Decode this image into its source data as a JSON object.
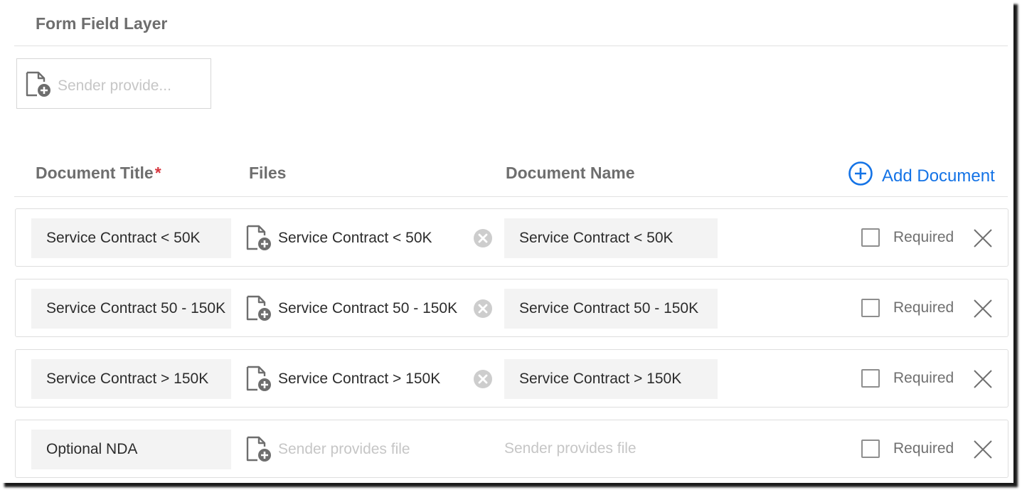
{
  "section": {
    "title": "Form Field Layer"
  },
  "layer_field": {
    "icon": "file-add-icon",
    "placeholder": "Sender provide..."
  },
  "columns": {
    "title": "Document Title",
    "required_marker": "*",
    "files": "Files",
    "name": "Document Name"
  },
  "add_document": {
    "icon": "add-circle-icon",
    "label": "Add Document"
  },
  "colors": {
    "accent": "#1473e6",
    "required_marker": "#d7373f",
    "placeholder": "#c6c6c6"
  },
  "rows": [
    {
      "title": "Service Contract < 50K",
      "file": "Service Contract < 50K",
      "document_name": "Service Contract < 50K",
      "required_label": "Required",
      "required_checked": false
    },
    {
      "title": "Service Contract 50 - 150K",
      "file": "Service Contract 50 - 150K",
      "document_name": "Service Contract 50 - 150K",
      "required_label": "Required",
      "required_checked": false
    },
    {
      "title": "Service Contract > 150K",
      "file": "Service Contract > 150K",
      "document_name": "Service Contract > 150K",
      "required_label": "Required",
      "required_checked": false
    },
    {
      "title": "Optional NDA",
      "file_placeholder": "Sender provides file",
      "document_name_placeholder": "Sender provides file",
      "required_label": "Required",
      "required_checked": false
    }
  ]
}
